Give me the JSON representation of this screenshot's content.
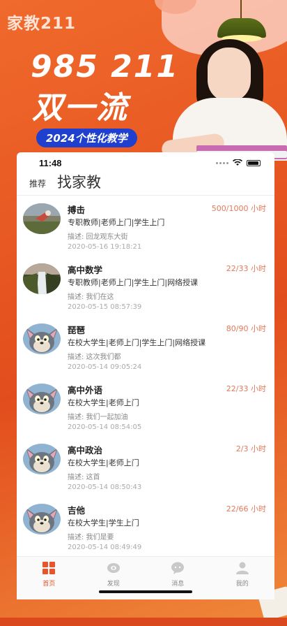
{
  "poster": {
    "logo": "家教211",
    "headline_1": "985 211",
    "headline_2": "双一流",
    "pill": "2024个性化教学"
  },
  "status_bar": {
    "time": "11:48"
  },
  "nav": {
    "recommend": "推荐",
    "title": "找家教"
  },
  "listings": [
    {
      "name": "搏击",
      "hours": "500/1000 小时",
      "tags": "专职教师|老师上门|学生上门",
      "desc": "描述: 回龙观东大街",
      "date": "2020-05-16 19:18:21",
      "avatar": "painting-avatar"
    },
    {
      "name": "高中数学",
      "hours": "22/33 小时",
      "tags": "专职教师|老师上门|学生上门|网络授课",
      "desc": "描述: 我们在这",
      "date": "2020-05-15 08:57:39",
      "avatar": "waterfall-avatar"
    },
    {
      "name": "琵琶",
      "hours": "80/90 小时",
      "tags": "在校大学生|老师上门|学生上门|网络授课",
      "desc": "描述: 这次我们都",
      "date": "2020-05-14 09:05:24",
      "avatar": "cat-avatar"
    },
    {
      "name": "高中外语",
      "hours": "22/33 小时",
      "tags": "在校大学生|老师上门",
      "desc": "描述: 我们一起加油",
      "date": "2020-05-14 08:54:05",
      "avatar": "cat-avatar"
    },
    {
      "name": "高中政治",
      "hours": "2/3 小时",
      "tags": "在校大学生|老师上门",
      "desc": "描述: 这首",
      "date": "2020-05-14 08:50:43",
      "avatar": "cat-avatar"
    },
    {
      "name": "吉他",
      "hours": "22/66 小时",
      "tags": "在校大学生|学生上门",
      "desc": "描述: 我们是要",
      "date": "2020-05-14 08:49:49",
      "avatar": "cat-avatar"
    }
  ],
  "tabs": [
    {
      "label": "首页",
      "icon": "home-grid-icon",
      "active": true
    },
    {
      "label": "发现",
      "icon": "eye-icon",
      "active": false
    },
    {
      "label": "消息",
      "icon": "message-icon",
      "active": false
    },
    {
      "label": "我的",
      "icon": "user-icon",
      "active": false
    }
  ],
  "colors": {
    "accent": "#e8552a",
    "hours": "#e07a5a",
    "poster_bg": "#e9561f",
    "pill": "#1f3fcf"
  }
}
